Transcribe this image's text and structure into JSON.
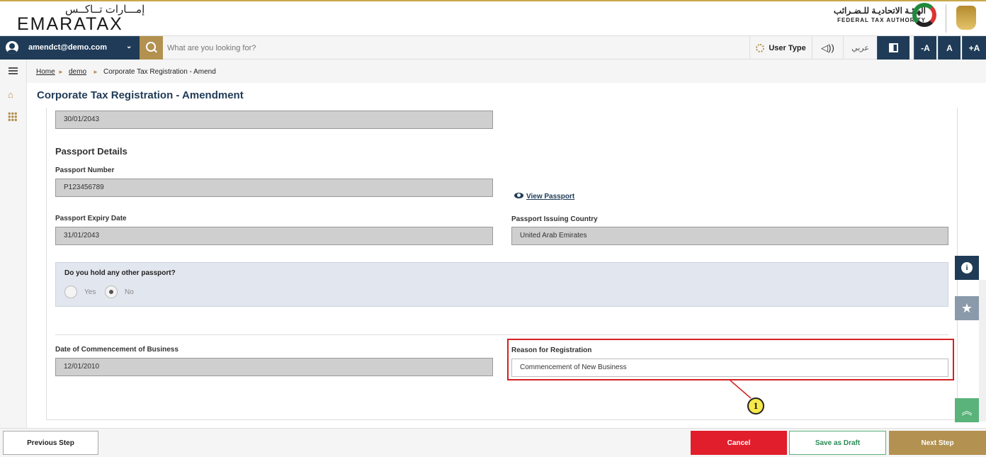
{
  "header": {
    "logo_ar": "إمـــارات تــاكــس",
    "logo_en": "EMARATAX",
    "fta_ar": "الهيئـة الاتحاديـة للـضـرائب",
    "fta_en": "FEDERAL TAX AUTHORITY"
  },
  "navbar": {
    "user_email": "amendct@demo.com",
    "search_placeholder": "What are you looking for?",
    "user_type": "User Type",
    "speaker": "◁))",
    "arabic": "عربي",
    "font_minus": "-A",
    "font_normal": "A",
    "font_plus": "+A"
  },
  "breadcrumb": {
    "home": "Home",
    "demo": "demo",
    "current": "Corporate Tax Registration - Amend",
    "sep": "►"
  },
  "page_title": "Corporate Tax Registration - Amendment",
  "form": {
    "top_date": "30/01/2043",
    "passport_section_title": "Passport Details",
    "passport_number_label": "Passport Number",
    "passport_number": "P123456789",
    "view_passport": "View Passport",
    "passport_expiry_label": "Passport Expiry Date",
    "passport_expiry": "31/01/2043",
    "passport_country_label": "Passport Issuing Country",
    "passport_country": "United Arab Emirates",
    "other_passport_question": "Do you hold any other passport?",
    "radio_yes": "Yes",
    "radio_no": "No",
    "radio_selected": "No",
    "commencement_label": "Date of Commencement of Business",
    "commencement_date": "12/01/2010",
    "reason_label": "Reason for Registration",
    "reason_value": "Commencement of New Business"
  },
  "callout": "1",
  "float_buttons": {
    "info": "i",
    "star": "★",
    "top": "︽"
  },
  "footer": {
    "previous": "Previous Step",
    "cancel": "Cancel",
    "save_draft": "Save as Draft",
    "next": "Next Step"
  },
  "colors": {
    "navy": "#1f3b57",
    "gold": "#b39150",
    "cancel_red": "#e11e2b",
    "highlight_red": "#d32222",
    "green": "#5ab37b"
  }
}
